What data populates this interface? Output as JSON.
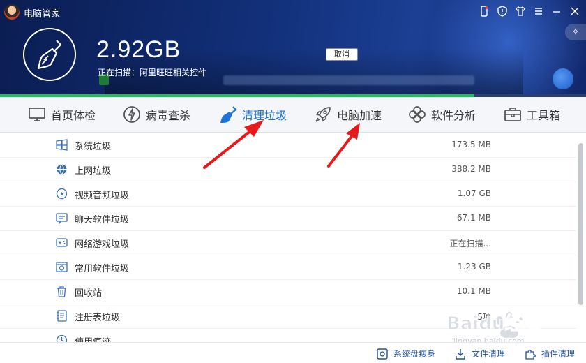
{
  "app": {
    "title": "电脑管家"
  },
  "scan": {
    "size": "2.92GB",
    "status": "正在扫描：阿里旺旺相关控件",
    "cancel_label": "取消",
    "progress": 0.81
  },
  "tabs": [
    {
      "label": "首页体检",
      "icon": "monitor-icon"
    },
    {
      "label": "病毒查杀",
      "icon": "lightning-icon"
    },
    {
      "label": "清理垃圾",
      "icon": "broom-icon",
      "active": true
    },
    {
      "label": "电脑加速",
      "icon": "rocket-icon"
    },
    {
      "label": "软件分析",
      "icon": "flower-icon"
    },
    {
      "label": "工具箱",
      "icon": "toolbox-icon"
    }
  ],
  "items": [
    {
      "label": "系统垃圾",
      "value": "173.5 MB",
      "icon": "windows-icon"
    },
    {
      "label": "上网垃圾",
      "value": "388.2 MB",
      "icon": "globe-icon"
    },
    {
      "label": "视频音频垃圾",
      "value": "1.07 GB",
      "icon": "play-icon"
    },
    {
      "label": "聊天软件垃圾",
      "value": "67.1 MB",
      "icon": "chat-icon"
    },
    {
      "label": "网络游戏垃圾",
      "value": "正在扫描...",
      "icon": "gamepad-icon"
    },
    {
      "label": "常用软件垃圾",
      "value": "1.23 GB",
      "icon": "software-icon"
    },
    {
      "label": "回收站",
      "value": "10.1 MB",
      "icon": "trash-icon"
    },
    {
      "label": "注册表垃圾",
      "value": "5项",
      "icon": "registry-icon"
    },
    {
      "label": "使用痕迹",
      "value": "",
      "icon": "clock-icon"
    }
  ],
  "footer": {
    "disk_slim": "系统盘瘦身",
    "file_clean": "文件清理",
    "plugin_clean": "插件清理"
  },
  "watermark": {
    "text": "Baidu经验",
    "sub": "jingyan.baidu.com"
  },
  "colors": {
    "accent": "#1e73d8",
    "progress": "#1cc05a",
    "arrow": "#e8191b"
  }
}
